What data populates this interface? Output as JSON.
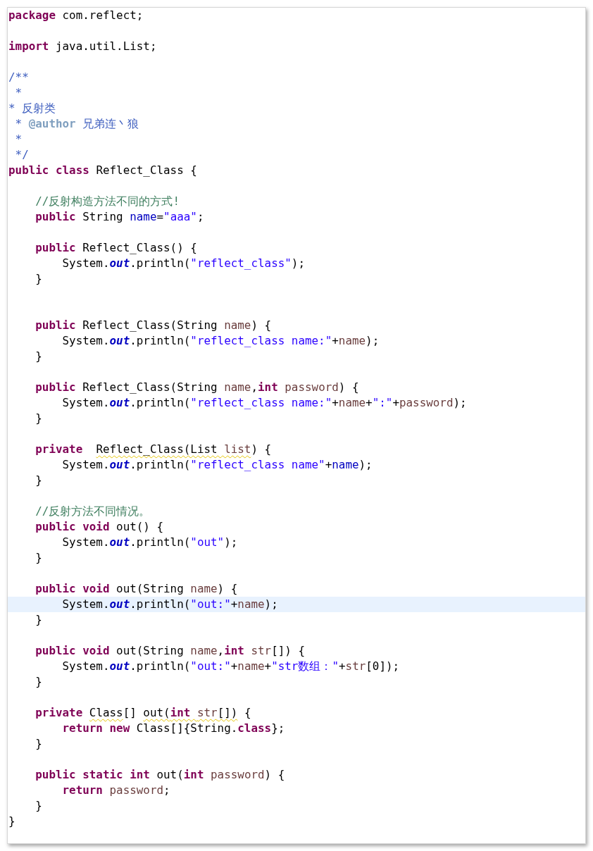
{
  "editor": {
    "lines": [
      {
        "highlighted": false,
        "tokens": [
          {
            "kind": "keyword",
            "text": "package ",
            "warning": false
          },
          {
            "kind": "plain",
            "text": "com.reflect;",
            "warning": false
          }
        ]
      },
      {
        "highlighted": false
      },
      {
        "highlighted": false,
        "tokens": [
          {
            "kind": "keyword",
            "text": "import ",
            "warning": false
          },
          {
            "kind": "plain",
            "text": "java.util.List;",
            "warning": false
          }
        ]
      },
      {
        "highlighted": false
      },
      {
        "highlighted": false,
        "tokens": [
          {
            "kind": "javadoc",
            "text": "/**",
            "warning": false
          }
        ]
      },
      {
        "highlighted": false,
        "tokens": [
          {
            "kind": "javadoc",
            "text": " *",
            "warning": false
          }
        ]
      },
      {
        "highlighted": false,
        "tokens": [
          {
            "kind": "javadoc",
            "text": "* 反射类",
            "warning": false
          }
        ]
      },
      {
        "highlighted": false,
        "tokens": [
          {
            "kind": "javadoc",
            "text": " * ",
            "warning": false
          },
          {
            "kind": "javadoc-tag",
            "text": "@author",
            "warning": false
          },
          {
            "kind": "javadoc",
            "text": " 兄弟连丶狼",
            "warning": false
          }
        ]
      },
      {
        "highlighted": false,
        "tokens": [
          {
            "kind": "javadoc",
            "text": " *",
            "warning": false
          }
        ]
      },
      {
        "highlighted": false,
        "tokens": [
          {
            "kind": "javadoc",
            "text": " */",
            "warning": false
          }
        ]
      },
      {
        "highlighted": false,
        "tokens": [
          {
            "kind": "keyword",
            "text": "public class ",
            "warning": false
          },
          {
            "kind": "plain",
            "text": "Reflect_Class {",
            "warning": false
          }
        ]
      },
      {
        "highlighted": false
      },
      {
        "highlighted": false,
        "tokens": [
          {
            "kind": "comment",
            "text": "    //反射构造方法不同的方式!",
            "warning": false
          }
        ]
      },
      {
        "highlighted": false,
        "tokens": [
          {
            "kind": "keyword",
            "text": "    public",
            "warning": false
          },
          {
            "kind": "plain",
            "text": " String ",
            "warning": false
          },
          {
            "kind": "field",
            "text": "name",
            "warning": false
          },
          {
            "kind": "plain",
            "text": "=",
            "warning": false
          },
          {
            "kind": "string",
            "text": "\"aaa\"",
            "warning": false
          },
          {
            "kind": "plain",
            "text": ";",
            "warning": false
          }
        ]
      },
      {
        "highlighted": false
      },
      {
        "highlighted": false,
        "tokens": [
          {
            "kind": "keyword",
            "text": "    public",
            "warning": false
          },
          {
            "kind": "plain",
            "text": " Reflect_Class() {",
            "warning": false
          }
        ]
      },
      {
        "highlighted": false,
        "tokens": [
          {
            "kind": "plain",
            "text": "        System.",
            "warning": false
          },
          {
            "kind": "static-field",
            "text": "out",
            "warning": false
          },
          {
            "kind": "plain",
            "text": ".println(",
            "warning": false
          },
          {
            "kind": "string",
            "text": "\"reflect_class\"",
            "warning": false
          },
          {
            "kind": "plain",
            "text": ");",
            "warning": false
          }
        ]
      },
      {
        "highlighted": false,
        "tokens": [
          {
            "kind": "plain",
            "text": "    }",
            "warning": false
          }
        ]
      },
      {
        "highlighted": false
      },
      {
        "highlighted": false
      },
      {
        "highlighted": false,
        "tokens": [
          {
            "kind": "keyword",
            "text": "    public",
            "warning": false
          },
          {
            "kind": "plain",
            "text": " Reflect_Class(String ",
            "warning": false
          },
          {
            "kind": "param",
            "text": "name",
            "warning": false
          },
          {
            "kind": "plain",
            "text": ") {",
            "warning": false
          }
        ]
      },
      {
        "highlighted": false,
        "tokens": [
          {
            "kind": "plain",
            "text": "        System.",
            "warning": false
          },
          {
            "kind": "static-field",
            "text": "out",
            "warning": false
          },
          {
            "kind": "plain",
            "text": ".println(",
            "warning": false
          },
          {
            "kind": "string",
            "text": "\"reflect_class name:\"",
            "warning": false
          },
          {
            "kind": "plain",
            "text": "+",
            "warning": false
          },
          {
            "kind": "param",
            "text": "name",
            "warning": false
          },
          {
            "kind": "plain",
            "text": ");",
            "warning": false
          }
        ]
      },
      {
        "highlighted": false,
        "tokens": [
          {
            "kind": "plain",
            "text": "    }",
            "warning": false
          }
        ]
      },
      {
        "highlighted": false
      },
      {
        "highlighted": false,
        "tokens": [
          {
            "kind": "keyword",
            "text": "    public",
            "warning": false
          },
          {
            "kind": "plain",
            "text": " Reflect_Class(String ",
            "warning": false
          },
          {
            "kind": "param",
            "text": "name",
            "warning": false
          },
          {
            "kind": "plain",
            "text": ",",
            "warning": false
          },
          {
            "kind": "keyword",
            "text": "int ",
            "warning": false
          },
          {
            "kind": "param",
            "text": "password",
            "warning": false
          },
          {
            "kind": "plain",
            "text": ") {",
            "warning": false
          }
        ]
      },
      {
        "highlighted": false,
        "tokens": [
          {
            "kind": "plain",
            "text": "        System.",
            "warning": false
          },
          {
            "kind": "static-field",
            "text": "out",
            "warning": false
          },
          {
            "kind": "plain",
            "text": ".println(",
            "warning": false
          },
          {
            "kind": "string",
            "text": "\"reflect_class name:\"",
            "warning": false
          },
          {
            "kind": "plain",
            "text": "+",
            "warning": false
          },
          {
            "kind": "param",
            "text": "name",
            "warning": false
          },
          {
            "kind": "plain",
            "text": "+",
            "warning": false
          },
          {
            "kind": "string",
            "text": "\":\"",
            "warning": false
          },
          {
            "kind": "plain",
            "text": "+",
            "warning": false
          },
          {
            "kind": "param",
            "text": "password",
            "warning": false
          },
          {
            "kind": "plain",
            "text": ");",
            "warning": false
          }
        ]
      },
      {
        "highlighted": false,
        "tokens": [
          {
            "kind": "plain",
            "text": "    }",
            "warning": false
          }
        ]
      },
      {
        "highlighted": false
      },
      {
        "highlighted": false,
        "tokens": [
          {
            "kind": "keyword",
            "text": "    private  ",
            "warning": false
          },
          {
            "kind": "plain",
            "text": "Reflect_Class(List ",
            "warning": true
          },
          {
            "kind": "param",
            "text": "list",
            "warning": true
          },
          {
            "kind": "plain",
            "text": ") {",
            "warning": false
          }
        ]
      },
      {
        "highlighted": false,
        "tokens": [
          {
            "kind": "plain",
            "text": "        System.",
            "warning": false
          },
          {
            "kind": "static-field",
            "text": "out",
            "warning": false
          },
          {
            "kind": "plain",
            "text": ".println(",
            "warning": false
          },
          {
            "kind": "string",
            "text": "\"reflect_class name\"",
            "warning": false
          },
          {
            "kind": "plain",
            "text": "+",
            "warning": false
          },
          {
            "kind": "field",
            "text": "name",
            "warning": false
          },
          {
            "kind": "plain",
            "text": ");",
            "warning": false
          }
        ]
      },
      {
        "highlighted": false,
        "tokens": [
          {
            "kind": "plain",
            "text": "    }",
            "warning": false
          }
        ]
      },
      {
        "highlighted": false
      },
      {
        "highlighted": false,
        "tokens": [
          {
            "kind": "comment",
            "text": "    //反射方法不同情况。",
            "warning": false
          }
        ]
      },
      {
        "highlighted": false,
        "tokens": [
          {
            "kind": "keyword",
            "text": "    public void",
            "warning": false
          },
          {
            "kind": "plain",
            "text": " out() {",
            "warning": false
          }
        ]
      },
      {
        "highlighted": false,
        "tokens": [
          {
            "kind": "plain",
            "text": "        System.",
            "warning": false
          },
          {
            "kind": "static-field",
            "text": "out",
            "warning": false
          },
          {
            "kind": "plain",
            "text": ".println(",
            "warning": false
          },
          {
            "kind": "string",
            "text": "\"out\"",
            "warning": false
          },
          {
            "kind": "plain",
            "text": ");",
            "warning": false
          }
        ]
      },
      {
        "highlighted": false,
        "tokens": [
          {
            "kind": "plain",
            "text": "    }",
            "warning": false
          }
        ]
      },
      {
        "highlighted": false
      },
      {
        "highlighted": false,
        "tokens": [
          {
            "kind": "keyword",
            "text": "    public void",
            "warning": false
          },
          {
            "kind": "plain",
            "text": " out(String ",
            "warning": false
          },
          {
            "kind": "param",
            "text": "name",
            "warning": false
          },
          {
            "kind": "plain",
            "text": ") {",
            "warning": false
          }
        ]
      },
      {
        "highlighted": true,
        "tokens": [
          {
            "kind": "plain",
            "text": "        System.",
            "warning": false
          },
          {
            "kind": "static-field",
            "text": "out",
            "warning": false
          },
          {
            "kind": "plain",
            "text": ".println(",
            "warning": false
          },
          {
            "kind": "string",
            "text": "\"out:\"",
            "warning": false
          },
          {
            "kind": "plain",
            "text": "+",
            "warning": false
          },
          {
            "kind": "param",
            "text": "name",
            "warning": false
          },
          {
            "kind": "plain",
            "text": ");",
            "warning": false
          }
        ]
      },
      {
        "highlighted": false,
        "tokens": [
          {
            "kind": "plain",
            "text": "    }",
            "warning": false
          }
        ]
      },
      {
        "highlighted": false
      },
      {
        "highlighted": false,
        "tokens": [
          {
            "kind": "keyword",
            "text": "    public void",
            "warning": false
          },
          {
            "kind": "plain",
            "text": " out(String ",
            "warning": false
          },
          {
            "kind": "param",
            "text": "name",
            "warning": false
          },
          {
            "kind": "plain",
            "text": ",",
            "warning": false
          },
          {
            "kind": "keyword",
            "text": "int ",
            "warning": false
          },
          {
            "kind": "param",
            "text": "str",
            "warning": false
          },
          {
            "kind": "plain",
            "text": "[]) {",
            "warning": false
          }
        ]
      },
      {
        "highlighted": false,
        "tokens": [
          {
            "kind": "plain",
            "text": "        System.",
            "warning": false
          },
          {
            "kind": "static-field",
            "text": "out",
            "warning": false
          },
          {
            "kind": "plain",
            "text": ".println(",
            "warning": false
          },
          {
            "kind": "string",
            "text": "\"out:\"",
            "warning": false
          },
          {
            "kind": "plain",
            "text": "+",
            "warning": false
          },
          {
            "kind": "param",
            "text": "name",
            "warning": false
          },
          {
            "kind": "plain",
            "text": "+",
            "warning": false
          },
          {
            "kind": "string",
            "text": "\"str数组：\"",
            "warning": false
          },
          {
            "kind": "plain",
            "text": "+",
            "warning": false
          },
          {
            "kind": "param",
            "text": "str",
            "warning": false
          },
          {
            "kind": "plain",
            "text": "[0]);",
            "warning": false
          }
        ]
      },
      {
        "highlighted": false,
        "tokens": [
          {
            "kind": "plain",
            "text": "    }",
            "warning": false
          }
        ]
      },
      {
        "highlighted": false
      },
      {
        "highlighted": false,
        "tokens": [
          {
            "kind": "keyword",
            "text": "    private ",
            "warning": false
          },
          {
            "kind": "plain",
            "text": "Class",
            "warning": true
          },
          {
            "kind": "plain",
            "text": "[] ",
            "warning": false
          },
          {
            "kind": "plain",
            "text": "out(",
            "warning": true
          },
          {
            "kind": "keyword",
            "text": "int ",
            "warning": true
          },
          {
            "kind": "param",
            "text": "str",
            "warning": true
          },
          {
            "kind": "plain",
            "text": "[])",
            "warning": true
          },
          {
            "kind": "plain",
            "text": " {",
            "warning": false
          }
        ]
      },
      {
        "highlighted": false,
        "tokens": [
          {
            "kind": "keyword",
            "text": "        return new",
            "warning": false
          },
          {
            "kind": "plain",
            "text": " Class[]{String.",
            "warning": false
          },
          {
            "kind": "keyword",
            "text": "class",
            "warning": false
          },
          {
            "kind": "plain",
            "text": "};",
            "warning": false
          }
        ]
      },
      {
        "highlighted": false,
        "tokens": [
          {
            "kind": "plain",
            "text": "    }",
            "warning": false
          }
        ]
      },
      {
        "highlighted": false
      },
      {
        "highlighted": false,
        "tokens": [
          {
            "kind": "keyword",
            "text": "    public static int",
            "warning": false
          },
          {
            "kind": "plain",
            "text": " out(",
            "warning": false
          },
          {
            "kind": "keyword",
            "text": "int ",
            "warning": false
          },
          {
            "kind": "param",
            "text": "password",
            "warning": false
          },
          {
            "kind": "plain",
            "text": ") {",
            "warning": false
          }
        ]
      },
      {
        "highlighted": false,
        "tokens": [
          {
            "kind": "keyword",
            "text": "        return ",
            "warning": false
          },
          {
            "kind": "param",
            "text": "password",
            "warning": false
          },
          {
            "kind": "plain",
            "text": ";",
            "warning": false
          }
        ]
      },
      {
        "highlighted": false,
        "tokens": [
          {
            "kind": "plain",
            "text": "    }",
            "warning": false
          }
        ]
      },
      {
        "highlighted": false,
        "tokens": [
          {
            "kind": "plain",
            "text": "}",
            "warning": false
          }
        ]
      }
    ]
  }
}
